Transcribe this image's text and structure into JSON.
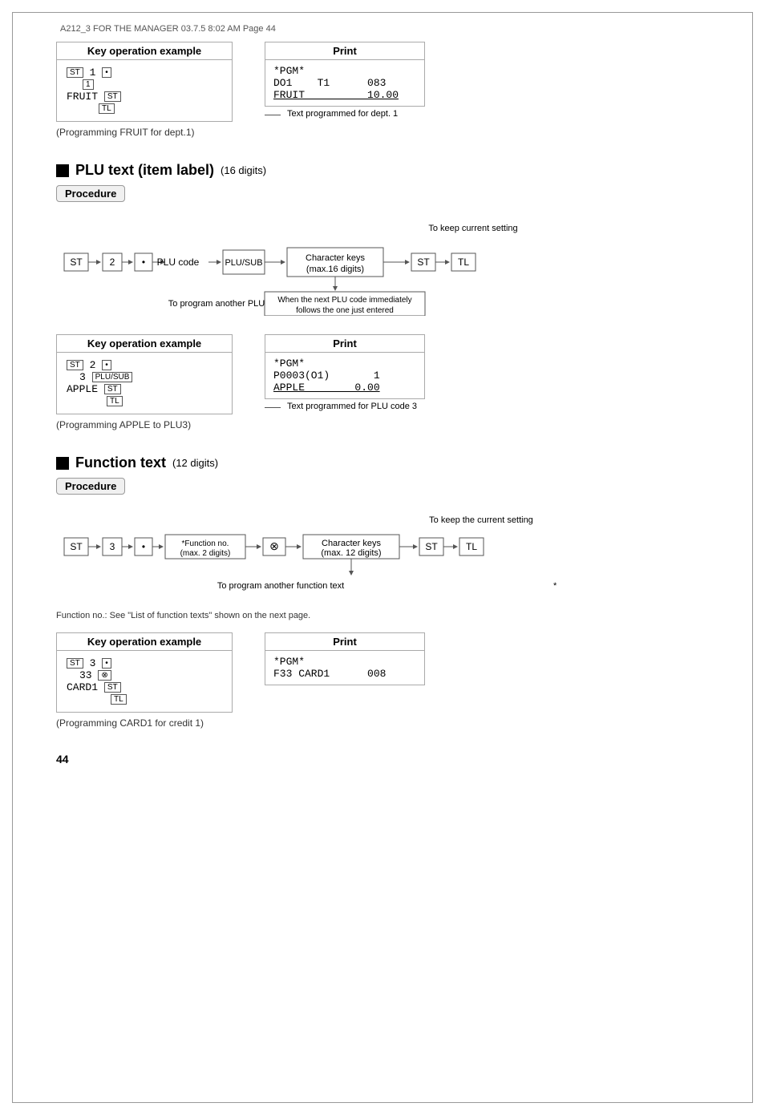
{
  "page_header": "A212_3  FOR THE MANAGER  03.7.5  8:02 AM  Page 44",
  "page_number": "44",
  "section1": {
    "key_op_label": "Key operation example",
    "print_label": "Print",
    "key_sequence": [
      "ST 1  •",
      "1",
      "FRUIT  ST",
      "TL"
    ],
    "caption": "(Programming FRUIT for dept.1)",
    "receipt": [
      "*PGM*",
      "DO1    T1      083",
      "FRUIT          10.00"
    ],
    "note": "Text programmed for dept. 1"
  },
  "section2": {
    "title": "PLU text (item label)",
    "subtitle": "(16 digits)",
    "procedure_label": "Procedure",
    "flow_note_top": "To keep current setting",
    "flow_note_bottom": "When the next PLU code immediately follows the one just entered",
    "flow_note_left": "To program another PLU",
    "boxes": [
      "ST",
      "2",
      "•",
      "PLU code",
      "PLU/SUB",
      "Character keys (max.16 digits)",
      "ST",
      "TL"
    ],
    "key_op_label": "Key operation example",
    "print_label": "Print",
    "key_sequence": [
      "ST 2  •",
      "3  PLU/SUB",
      "APPLE  ST",
      "TL"
    ],
    "caption": "(Programming APPLE to PLU3)",
    "receipt": [
      "*PGM*",
      "P0003(O1)       1",
      "APPLE        0.00"
    ],
    "note": "Text programmed for PLU code 3"
  },
  "section3": {
    "title": "Function text",
    "subtitle": "(12 digits)",
    "procedure_label": "Procedure",
    "flow_note_top": "To keep the current setting",
    "flow_note_bottom": "To program another function text",
    "boxes": [
      "ST",
      "3",
      "•",
      "*Function no. (max. 2 digits)",
      "⊗",
      "Character keys (max. 12 digits)",
      "ST",
      "TL"
    ],
    "star_note": "*",
    "function_note": "Function no.: See \"List of function texts\" shown on the next page.",
    "key_op_label": "Key operation example",
    "print_label": "Print",
    "key_sequence": [
      "ST 3  •",
      "33  ⊗",
      "CARD1  ST",
      "TL"
    ],
    "caption": "(Programming CARD1 for credit 1)",
    "receipt": [
      "*PGM*",
      "F33 CARD1      008"
    ]
  }
}
